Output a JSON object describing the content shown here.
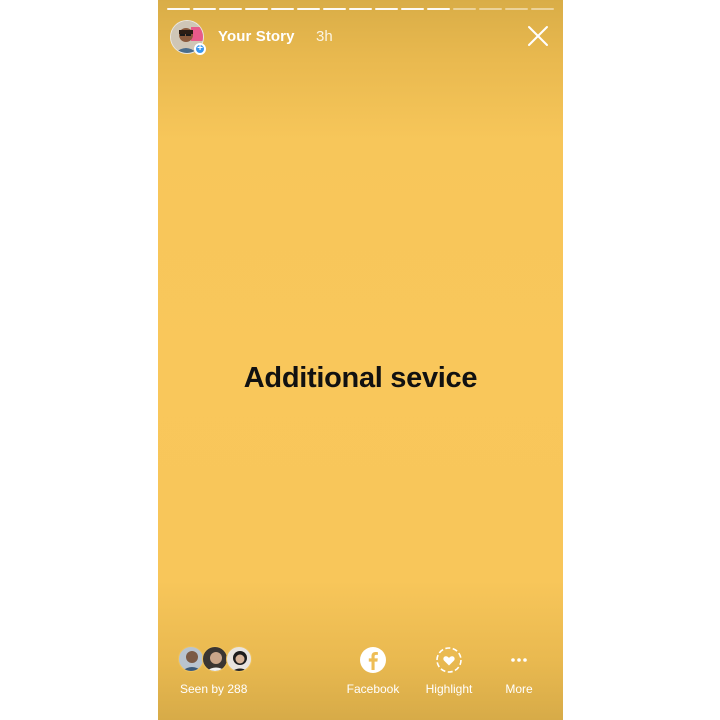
{
  "story": {
    "title": "Your Story",
    "time": "3h",
    "text": "Additional sevice",
    "background": "#f9c75b",
    "progress_segments": 15,
    "progress_viewed": 11
  },
  "footer": {
    "seen_label": "Seen by 288",
    "actions": [
      {
        "label": "Facebook",
        "icon": "facebook-icon"
      },
      {
        "label": "Highlight",
        "icon": "highlight-icon"
      },
      {
        "label": "More",
        "icon": "more-icon"
      }
    ]
  },
  "icons": {
    "close": "close-icon",
    "add": "add-story-icon"
  }
}
